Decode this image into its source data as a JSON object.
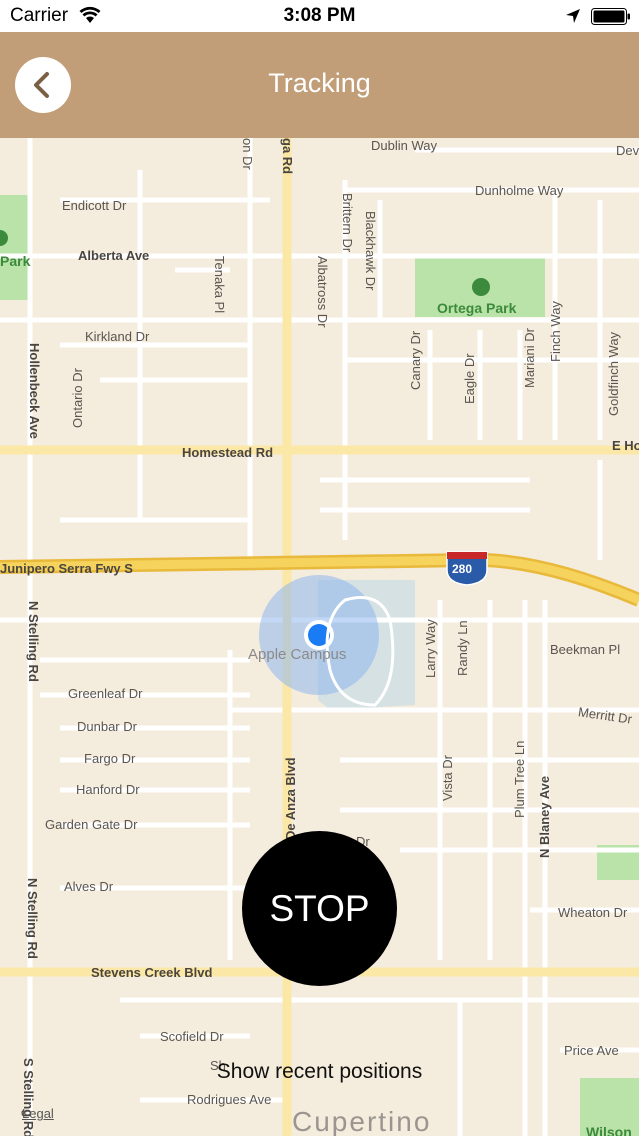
{
  "status": {
    "carrier": "Carrier",
    "time": "3:08 PM"
  },
  "nav": {
    "title": "Tracking",
    "back_icon": "chevron-left-icon"
  },
  "map": {
    "streets": [
      "Dublin Way",
      "Dev",
      "Endicott Dr",
      "Dunholme Way",
      "Alberta Ave",
      "Tenaka Pl",
      "Albatross Dr",
      "Brittern Dr",
      "Blackhawk Dr",
      "Kirkland Dr",
      "Ontario Dr",
      "Hollenbeck Ave",
      "Canary Dr",
      "Eagle Dr",
      "Mariani Dr",
      "Finch Way",
      "Goldfinch Way",
      "Homestead Rd",
      "E Ho",
      "Junipero Serra Fwy S",
      "N Stelling Rd",
      "Larry Way",
      "Randy Ln",
      "Beekman Pl",
      "Greenleaf Dr",
      "Merritt Dr",
      "Dunbar Dr",
      "Fargo Dr",
      "N De Anza Blvd",
      "Vista Dr",
      "Plum Tree Ln",
      "N Blaney Ave",
      "Hanford Dr",
      "Garden Gate Dr",
      "Dr",
      "Alves Dr",
      "N Stelling Rd",
      "Wheaton Dr",
      "Stevens Creek Blvd",
      "Scofield Dr",
      "Price Ave",
      "Rodrigues Ave",
      "S Stelling Rd",
      "ga Rd",
      "on Dr",
      "Sh"
    ],
    "parks": [
      "Ortega Park",
      "Park",
      "Wilson"
    ],
    "campus": "Apple Campus",
    "city": "Cupertino",
    "highway_shield": "280"
  },
  "stop_label": "STOP",
  "recent_label": "Show recent positions",
  "legal_label": "Legal",
  "colors": {
    "nav_bg": "#c19e78",
    "map_bg": "#f4ecdc",
    "road": "#ffffff",
    "major_road": "#fbe7a6",
    "freeway": "#f2c94c",
    "park": "#b9e3a8",
    "location_dot": "#1a7cf5"
  }
}
